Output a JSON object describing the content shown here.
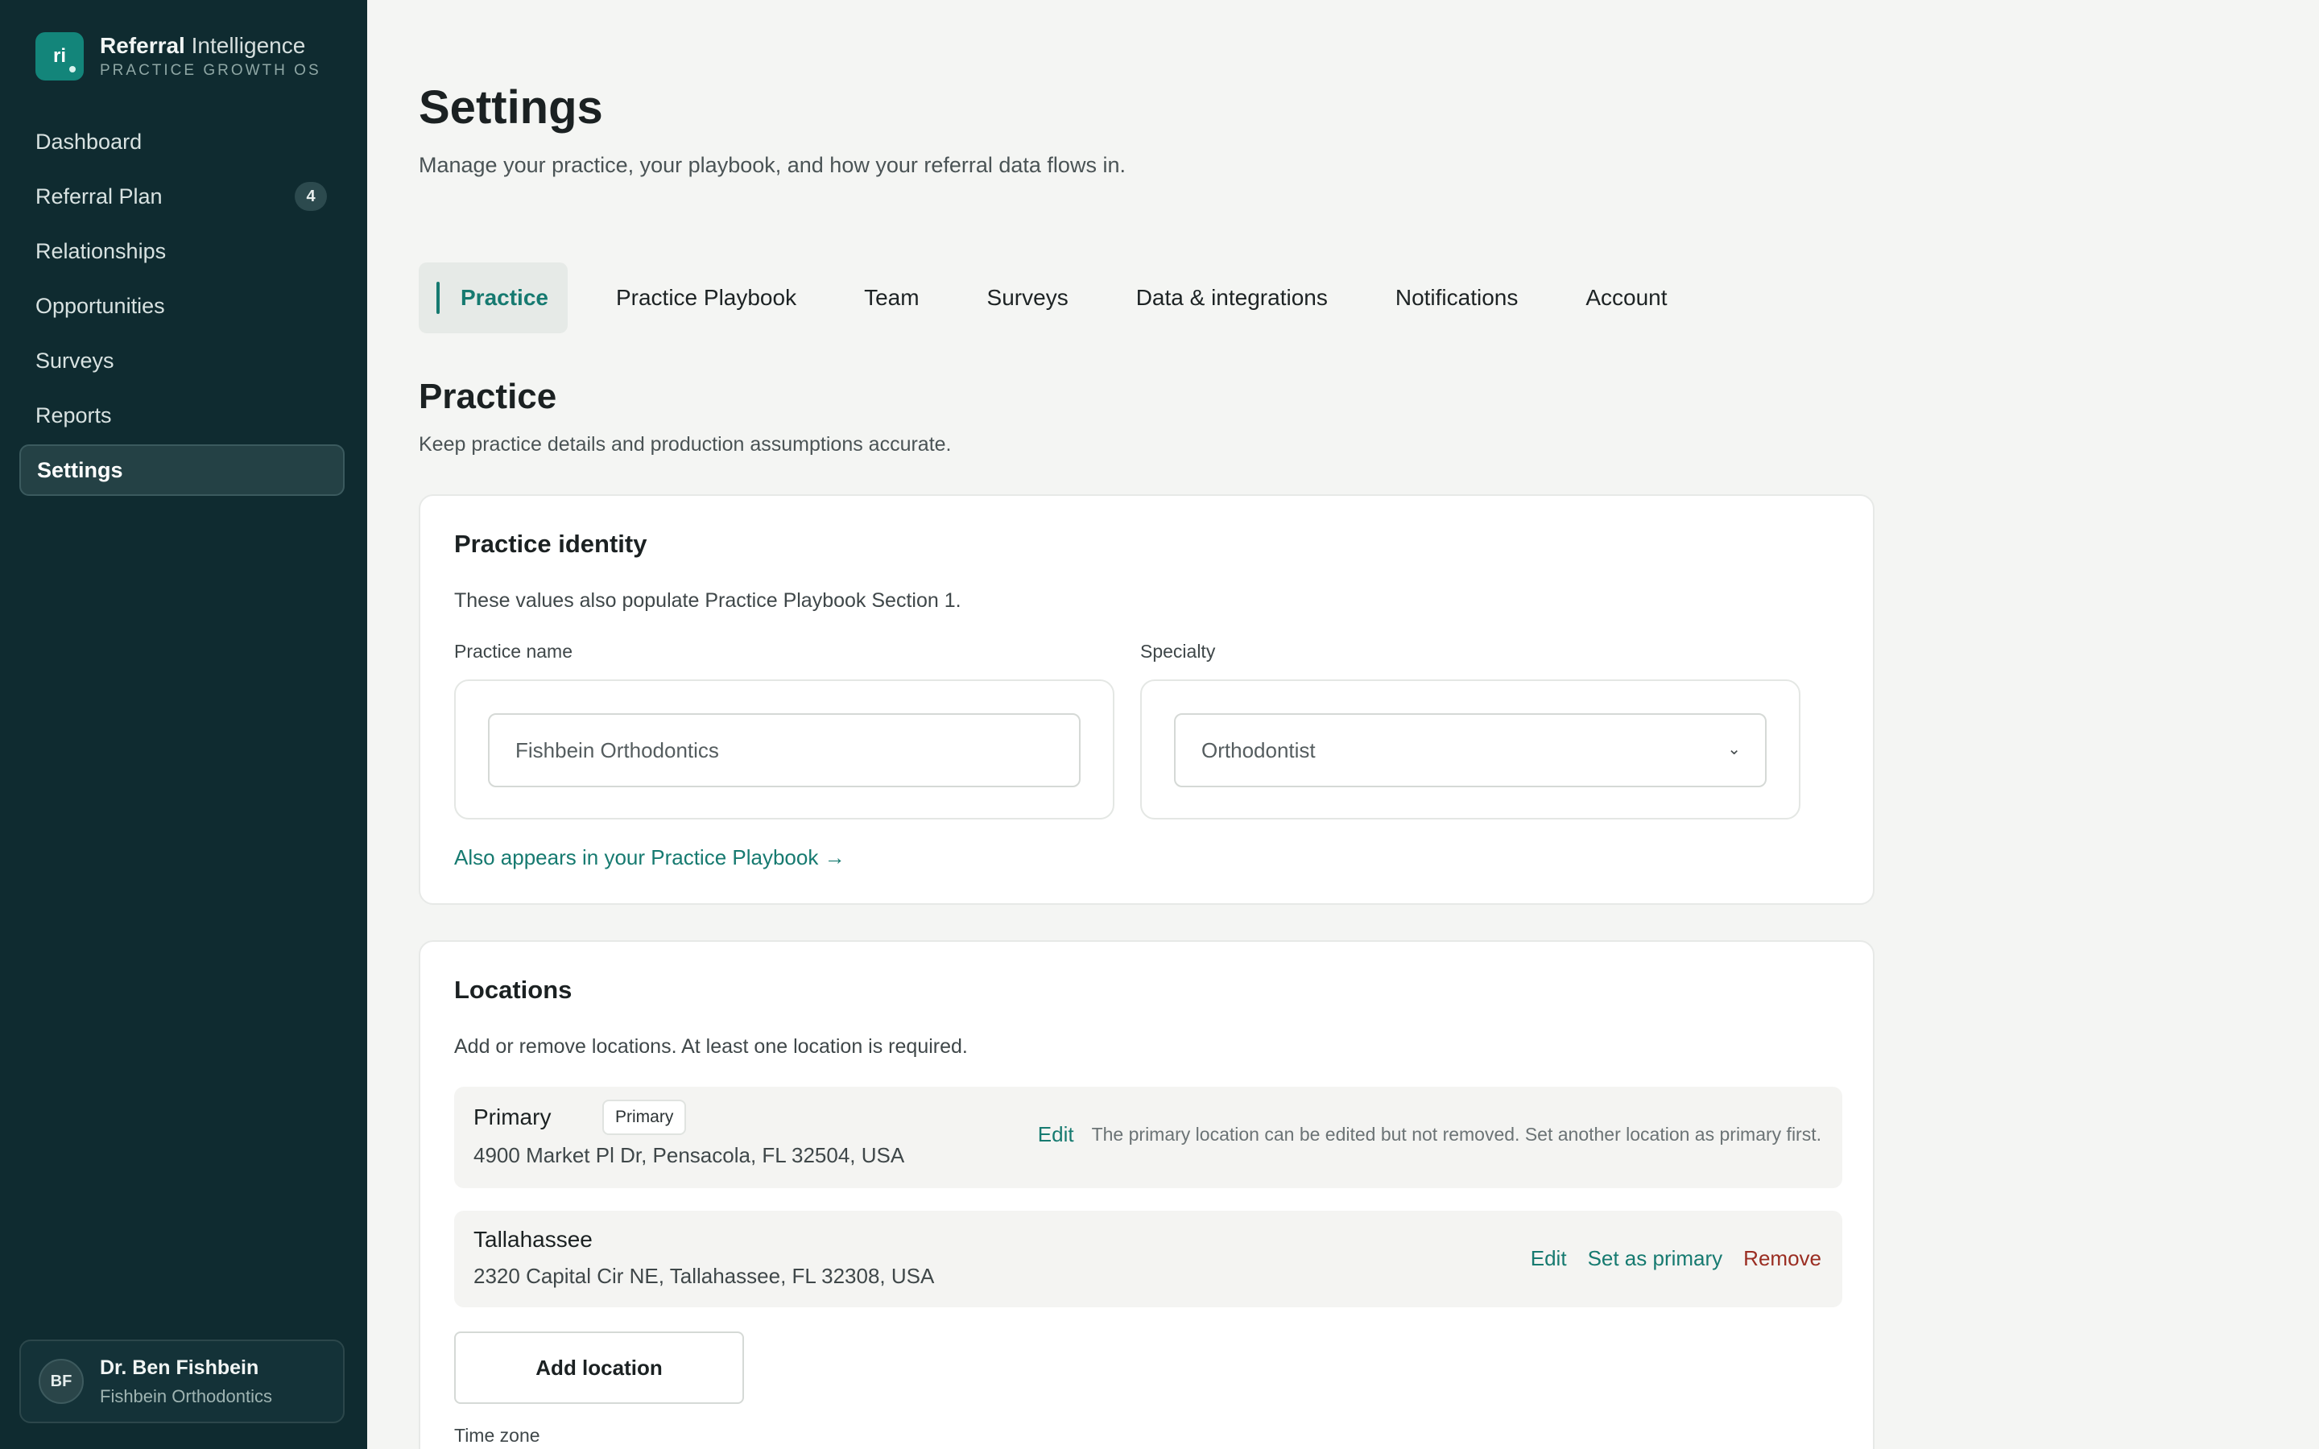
{
  "brand": {
    "logo": "ri",
    "name_strong": "Referral",
    "name_light": "Intelligence",
    "tagline": "PRACTICE GROWTH OS"
  },
  "nav": {
    "items": [
      {
        "label": "Dashboard"
      },
      {
        "label": "Referral Plan",
        "badge": "4"
      },
      {
        "label": "Relationships"
      },
      {
        "label": "Opportunities"
      },
      {
        "label": "Surveys"
      },
      {
        "label": "Reports"
      },
      {
        "label": "Settings",
        "active": true
      }
    ]
  },
  "user": {
    "initials": "BF",
    "name": "Dr. Ben Fishbein",
    "org": "Fishbein Orthodontics"
  },
  "page": {
    "title": "Settings",
    "subtitle": "Manage your practice, your playbook, and how your referral data flows in."
  },
  "tabs": [
    {
      "label": "Practice",
      "active": true
    },
    {
      "label": "Practice Playbook"
    },
    {
      "label": "Team"
    },
    {
      "label": "Surveys"
    },
    {
      "label": "Data & integrations"
    },
    {
      "label": "Notifications"
    },
    {
      "label": "Account"
    }
  ],
  "section": {
    "title": "Practice",
    "subtitle": "Keep practice details and production assumptions accurate."
  },
  "identity": {
    "title": "Practice identity",
    "description": "These values also populate Practice Playbook Section 1.",
    "practice_name_label": "Practice name",
    "practice_name_value": "Fishbein Orthodontics",
    "specialty_label": "Specialty",
    "specialty_value": "Orthodontist",
    "playbook_link": "Also appears in your Practice Playbook →"
  },
  "locations": {
    "title": "Locations",
    "description": "Add or remove locations. At least one location is required.",
    "items": [
      {
        "name": "Primary",
        "badge": "Primary",
        "address": "4900 Market Pl Dr, Pensacola, FL 32504, USA",
        "edit_label": "Edit",
        "note": "The primary location can be edited but not removed. Set another location as primary first."
      },
      {
        "name": "Tallahassee",
        "address": "2320 Capital Cir NE, Tallahassee, FL 32308, USA",
        "edit_label": "Edit",
        "set_primary_label": "Set as primary",
        "remove_label": "Remove"
      }
    ],
    "add_button": "Add location",
    "timezone_label": "Time zone"
  },
  "colors": {
    "sidebar_bg": "#0f2b30",
    "accent": "#167a70",
    "danger": "#9a2d22",
    "page_bg": "#f4f5f3"
  }
}
